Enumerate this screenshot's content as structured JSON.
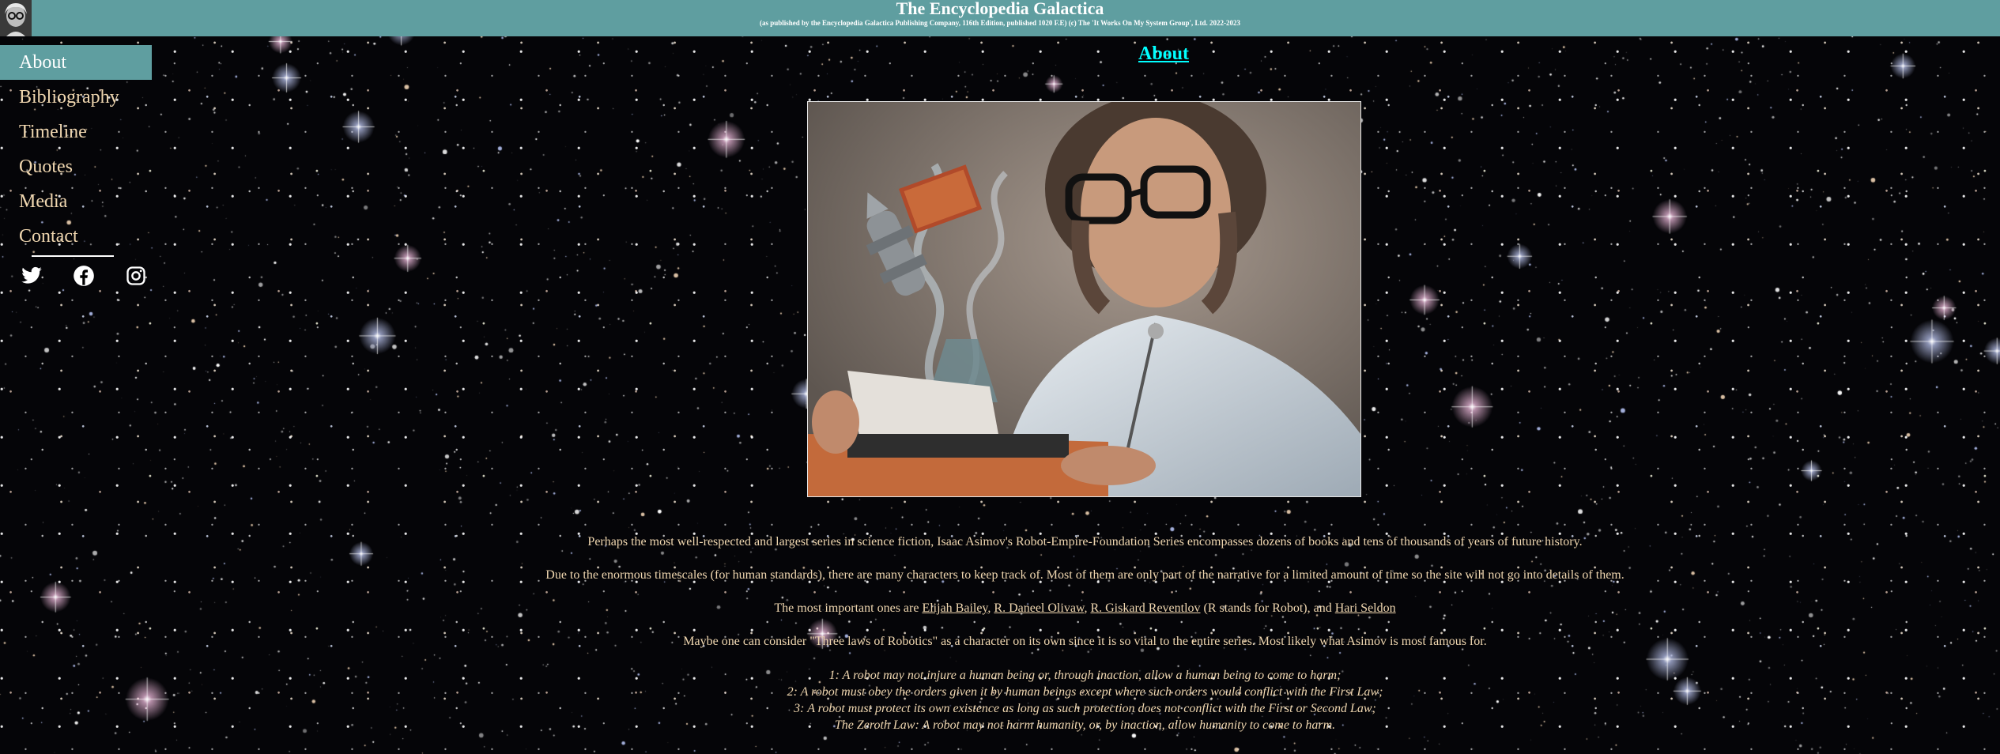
{
  "header": {
    "title": "The Encyclopedia Galactica",
    "subtitle": "(as published by the Encyclopedia Galactica Publishing Company, 116th Edition, published 1020 F.E) (c) The 'It Works On My System Group', Ltd. 2022-2023"
  },
  "nav": [
    {
      "label": "About",
      "active": true
    },
    {
      "label": "Bibliography"
    },
    {
      "label": "Timeline"
    },
    {
      "label": "Quotes"
    },
    {
      "label": "Media"
    },
    {
      "label": "Contact"
    }
  ],
  "socials": [
    "twitter-icon",
    "facebook-icon",
    "instagram-icon"
  ],
  "main": {
    "title": "About",
    "intro": "Perhaps the most well-respected and largest series in science fiction, Isaac Asimov's Robot-Empire-Foundation Series encompasses dozens of books and tens of thousands of years of future history.",
    "timescale": "Due to the enormous timescales (for human standards), there are many characters to keep track of. Most of them are only part of the narrative for a limited amount of time so the site will not go into details of them.",
    "characters_prefix": "The most important ones are ",
    "characters": [
      "Elijah Bailey",
      "R. Daneel Olivaw",
      "R. Giskard Reventlov",
      "Hari Seldon"
    ],
    "sep1": ", ",
    "sep2": ", ",
    "sep3": " (R stands for Robot), and ",
    "laws_intro": "Maybe one can consider \"Three laws of Robotics\" as a character on its own since it is so vital to the entire series. Most likely what Asimov is most famous for.",
    "laws": [
      "1: A robot may not injure a human being or, through inaction, allow a human being to come to harm;",
      "2: A robot must obey the orders given it by human beings except where such orders would conflict with the First Law;",
      "3: A robot must protect its own existence as long as such protection does not conflict with the First or Second Law;",
      "The Zeroth Law: A robot may not harm humanity, or, by inaction, allow humanity to come to harm."
    ]
  },
  "colors": {
    "header_bg": "#5f9ea0",
    "nav_text": "#f0d7b0",
    "title": "#00ffff"
  }
}
